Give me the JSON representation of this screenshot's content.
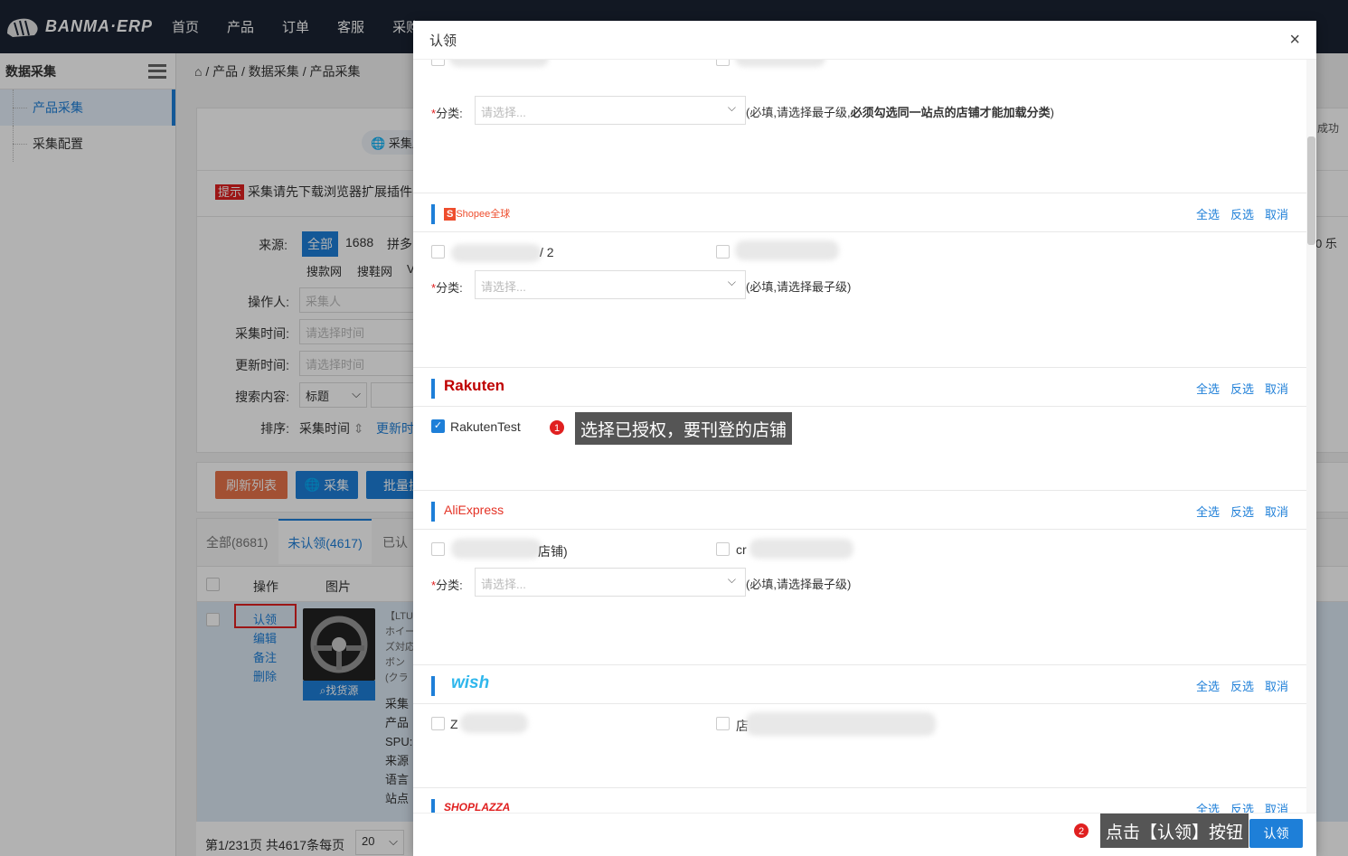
{
  "app": {
    "logo": "BANMA·ERP",
    "nav": [
      "首页",
      "产品",
      "订单",
      "客服",
      "采购"
    ]
  },
  "sidebar": {
    "title": "数据采集",
    "items": [
      "产品采集",
      "采集配置"
    ]
  },
  "breadcrumb": "/ 产品 / 数据采集 / 产品采集",
  "page": {
    "collect_tab": "采集产",
    "tip_badge": "提示",
    "tip_text": "采集请先下载浏览器扩展插件",
    "source_label": "来源:",
    "sources_row1": [
      "全部",
      "1688",
      "拼多"
    ],
    "sources_row2": [
      "搜款网",
      "搜鞋网",
      "V"
    ],
    "operator_label": "操作人:",
    "operator_placeholder": "采集人",
    "collect_time_label": "采集时间:",
    "update_time_label": "更新时间:",
    "time_placeholder": "请选择时间",
    "search_label": "搜索内容:",
    "search_field": "标题",
    "sort_label": "排序:",
    "sort_value": "采集时间",
    "sort_link": "更新时",
    "btn_refresh": "刷新列表",
    "btn_collect": "采集",
    "btn_batch": "批量操",
    "tabs": [
      "全部(8681)",
      "未认领(4617)",
      "已认"
    ],
    "col_ops": "操作",
    "col_img": "图片",
    "row_actions": [
      "认领",
      "编辑",
      "备注",
      "删除"
    ],
    "find_source": "找货源",
    "row_text": [
      "【LTU",
      "ホイー",
      "ズ対応",
      "ボン",
      "(クラ"
    ],
    "row_meta": [
      "采集",
      "产品",
      "SPU:",
      "来源",
      "语言",
      "站点"
    ],
    "pagination": "第1/231页 共4617条每页",
    "page_size": "20",
    "right_edge": [
      "成功",
      "0 乐"
    ]
  },
  "modal": {
    "title": "认领",
    "close": "×",
    "category_label": "分类:",
    "category_placeholder": "请选择...",
    "top_hint_pre": "(必填,请选择最子级,",
    "top_hint_bold": "必须勾选同一站点的店铺才能加载分类",
    "top_hint_post": ")",
    "hint": "(必填,请选择最子级)",
    "actions": [
      "全选",
      "反选",
      "取消"
    ],
    "platforms": {
      "shopee": "Shopee全球",
      "rakuten": "Rakuten",
      "aliexpress": "AliExpress",
      "wish": "wish",
      "shoplazza": "SHOPLAZZA"
    },
    "shops": {
      "shopee_1_tail": "/ 2",
      "rakuten_1": "RakutenTest",
      "ali_1_tail": "店铺)",
      "ali_2_head": "cr",
      "wish_1_head": "Z",
      "wish_2_head": "店"
    },
    "tooltip1": "选择已授权，要刊登的店铺",
    "tooltip2": "点击【认领】按钮",
    "step1": "1",
    "step2": "2",
    "confirm": "认领"
  },
  "colors": {
    "accent": "#1e7fd8",
    "refresh": "#e8734a",
    "danger": "#e02020",
    "topbar": "#1a2333"
  }
}
